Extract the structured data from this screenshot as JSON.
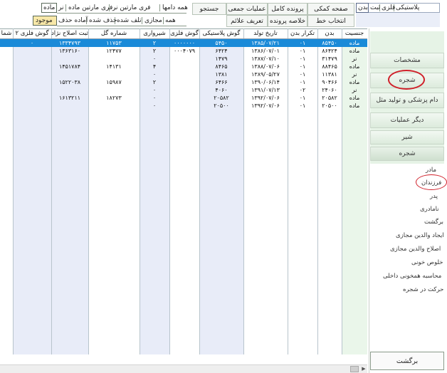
{
  "top_tabs_right": [
    "پلاستیکی",
    "فلزی",
    "ثبت",
    "بدن"
  ],
  "top_tabs_left_row1": [
    "همه دامها",
    "فری مارتین نر",
    "فری مارتین ماده",
    "نر",
    "ماده"
  ],
  "top_tabs_left_row2": [
    "همه",
    "مجازی",
    "تلف شده",
    "حذف شده",
    "آماده حذف",
    "موجود"
  ],
  "toolbar": {
    "help_page": "صفحه کمکی",
    "full_file": "پرونده کامل",
    "group_ops": "عملیات جمعی",
    "search": "جستجو",
    "select_line": "انتخاب خط",
    "file_summary": "خلاصه پرونده",
    "define_marks": "تعریف علائم"
  },
  "table": {
    "columns": [
      "جنسیت",
      "بدن",
      "تکرار بدن",
      "تاریخ تولد",
      "گوش پلاستیکی",
      "گوش فلزی",
      "شیرواری",
      "شماره گل",
      "ثبت اصلاح نژاد",
      "گوش فلزی ۲",
      "شما"
    ],
    "rows": [
      [
        "ماده",
        "۸۵۴۵۰",
        "۰۱",
        "۱۳۸۵/۰۷/۲۱",
        "۵۴۵۰",
        "۰۰۰۰۰۰۰",
        "۲",
        "۱۱۷۵۳",
        "۱۳۳۴۷۹۳",
        "۰",
        ""
      ],
      [
        "ماده",
        "۸۶۴۲۴",
        "۰۱",
        "۱۳۸۶/۰۷/۰۱",
        "۶۴۲۴",
        "۰۰۰۴۰۷۹",
        "۲",
        "۱۲۴۷۷",
        "۱۳۶۳۱۶۰",
        "",
        ""
      ],
      [
        "نر",
        "۳۱۴۷۹",
        "۰۱",
        "۱۳۸۷/۰۷/۱۰",
        "۱۴۷۹",
        "",
        "۰",
        "",
        "",
        "",
        ""
      ],
      [
        "ماده",
        "۸۸۴۶۵",
        "۰۱",
        "۱۳۸۸/۰۷/۰۶",
        "۸۴۶۵",
        "",
        "۴",
        "۱۴۱۳۱",
        "۱۴۵۱۷۸۴",
        "",
        ""
      ],
      [
        "نر",
        "۱۱۳۸۱",
        "۰۱",
        "۱۳۸۹/۰۵/۲۷",
        "۱۳۸۱",
        "",
        "۰",
        "",
        "",
        "",
        ""
      ],
      [
        "ماده",
        "۹۰۴۶۶",
        "۰۱",
        "۱۳۹۰/۰۶/۱۴",
        "۶۴۶۶",
        "",
        "۲",
        "۱۵۹۸۷",
        "۱۵۲۲۰۳۸",
        "",
        ""
      ],
      [
        "نر",
        "۲۴۰۶۰",
        "۰۲",
        "۱۳۹۱/۰۷/۱۳",
        "۴۰۶۰",
        "",
        "۰",
        "",
        "",
        "",
        ""
      ],
      [
        "ماده",
        "۲۰۵۸۲",
        "۰۱",
        "۱۳۹۲/۰۷/۰۶",
        "۲۰۵۸۲",
        "",
        "۰",
        "۱۸۲۷۳",
        "۱۶۱۳۲۱۱",
        "",
        ""
      ],
      [
        "ماده",
        "۲۰۵۰۰",
        "۰۱",
        "۱۳۹۲/۰۷/۰۶",
        "۲۰۵۰۰",
        "",
        "۰",
        "",
        "",
        "",
        ""
      ]
    ]
  },
  "sidebar": {
    "specs": "مشخصات",
    "tree_btn": "شجره",
    "vet": "دام پزشکی و تولید مثل",
    "other_ops": "دیگر عملیات",
    "milk": "شیر",
    "tree": "شجره",
    "links": [
      "مادر",
      "فرزندان",
      "پدر",
      "نامادری",
      "برگشت",
      "ایجاد والدین مجازی",
      "اصلاح والدین مجازی",
      "خلوص خونی",
      "محاسبه همخونی داخلی",
      "حرکت در شجره"
    ],
    "back": "برگشت"
  },
  "colors": {
    "selected_row": "#1a8ad8",
    "column_tint": "#e8ecf8",
    "highlight_red": "#d0202a"
  }
}
